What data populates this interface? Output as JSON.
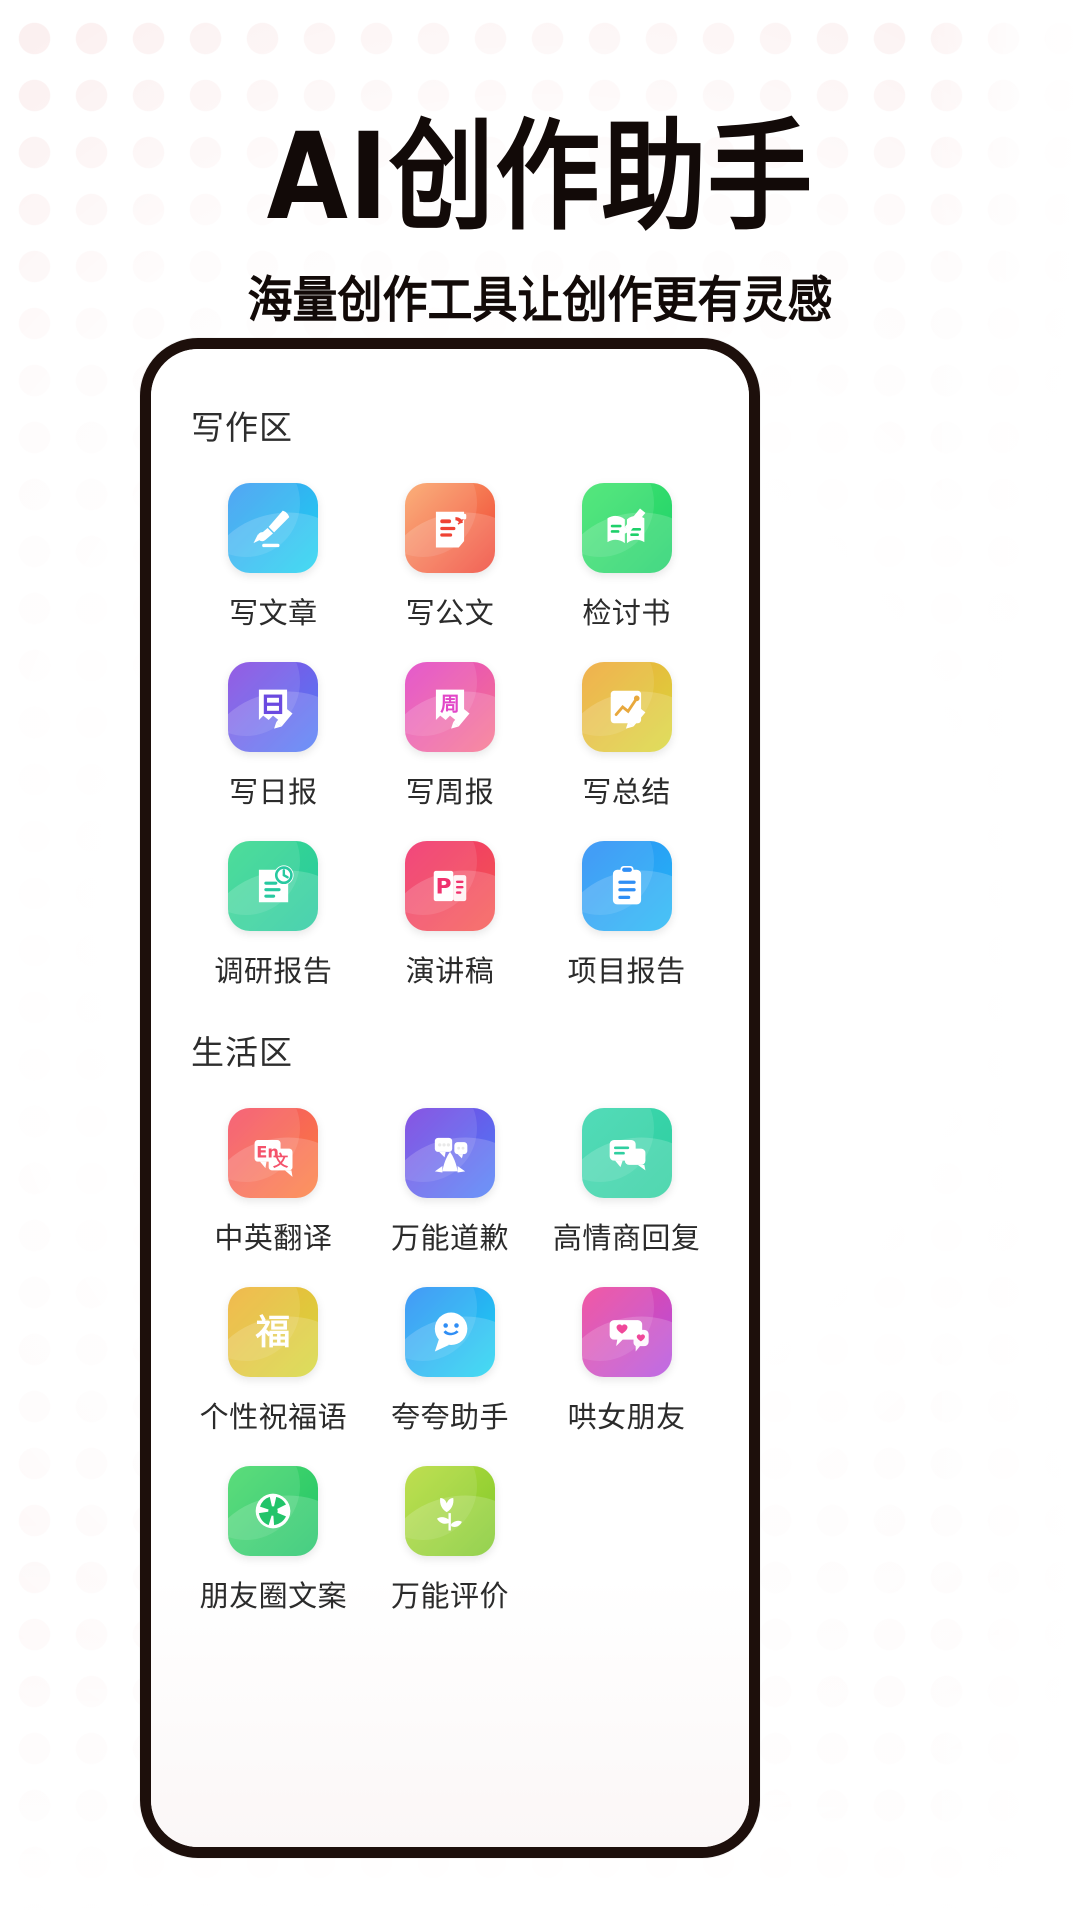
{
  "header": {
    "title": "AI创作助手",
    "subtitle": "海量创作工具让创作更有灵感",
    "title_color": "#120a08"
  },
  "theme": {
    "background": "#ffffff",
    "dot_color": "#f6dada",
    "phone_border": "#1d0f0b",
    "label_color": "#2b2b2b",
    "section_title_color": "#2d2d2d"
  },
  "sections": [
    {
      "title": "写作区",
      "items": [
        {
          "label": "写文章",
          "icon": "fountain-pen-icon",
          "grad_from": "#3f9bf2",
          "grad_to": "#1fd4f0"
        },
        {
          "label": "写公文",
          "icon": "official-document-icon",
          "grad_from": "#fba76b",
          "grad_to": "#ef4335"
        },
        {
          "label": "检讨书",
          "icon": "open-book-pen-icon",
          "grad_from": "#43e56f",
          "grad_to": "#1fd06a"
        },
        {
          "label": "写日报",
          "icon": "daily-report-icon",
          "grad_from": "#8a4ae0",
          "grad_to": "#4f7ef6"
        },
        {
          "label": "写周报",
          "icon": "weekly-report-icon",
          "grad_from": "#e247c8",
          "grad_to": "#f6748c"
        },
        {
          "label": "写总结",
          "icon": "summary-chart-icon",
          "grad_from": "#f0a83c",
          "grad_to": "#d8d83c"
        },
        {
          "label": "调研报告",
          "icon": "research-clock-icon",
          "grad_from": "#3ad98e",
          "grad_to": "#27c9a0"
        },
        {
          "label": "演讲稿",
          "icon": "presentation-p-icon",
          "grad_from": "#f0326e",
          "grad_to": "#f4584f"
        },
        {
          "label": "项目报告",
          "icon": "clipboard-icon",
          "grad_from": "#2f8ef5",
          "grad_to": "#22b8f5"
        }
      ]
    },
    {
      "title": "生活区",
      "items": [
        {
          "label": "中英翻译",
          "icon": "translate-en-icon",
          "grad_from": "#f4526b",
          "grad_to": "#fb7f3d"
        },
        {
          "label": "万能道歉",
          "icon": "praying-hands-icon",
          "grad_from": "#7a41e0",
          "grad_to": "#4d80f7"
        },
        {
          "label": "高情商回复",
          "icon": "chat-bubbles-icon",
          "grad_from": "#3fd7b0",
          "grad_to": "#2fcfa0"
        },
        {
          "label": "个性祝福语",
          "icon": "fortune-fu-icon",
          "grad_from": "#f0b23c",
          "grad_to": "#d4d83c"
        },
        {
          "label": "夸夸助手",
          "icon": "smile-bubble-icon",
          "grad_from": "#2f8ef5",
          "grad_to": "#1fd6f0"
        },
        {
          "label": "哄女朋友",
          "icon": "heart-chat-icon",
          "grad_from": "#f0479a",
          "grad_to": "#b14fe0"
        },
        {
          "label": "朋友圈文案",
          "icon": "camera-shutter-icon",
          "grad_from": "#4ad96b",
          "grad_to": "#22c46a"
        },
        {
          "label": "万能评价",
          "icon": "tulip-flower-icon",
          "grad_from": "#b8dc3c",
          "grad_to": "#7fc92f"
        }
      ]
    }
  ]
}
